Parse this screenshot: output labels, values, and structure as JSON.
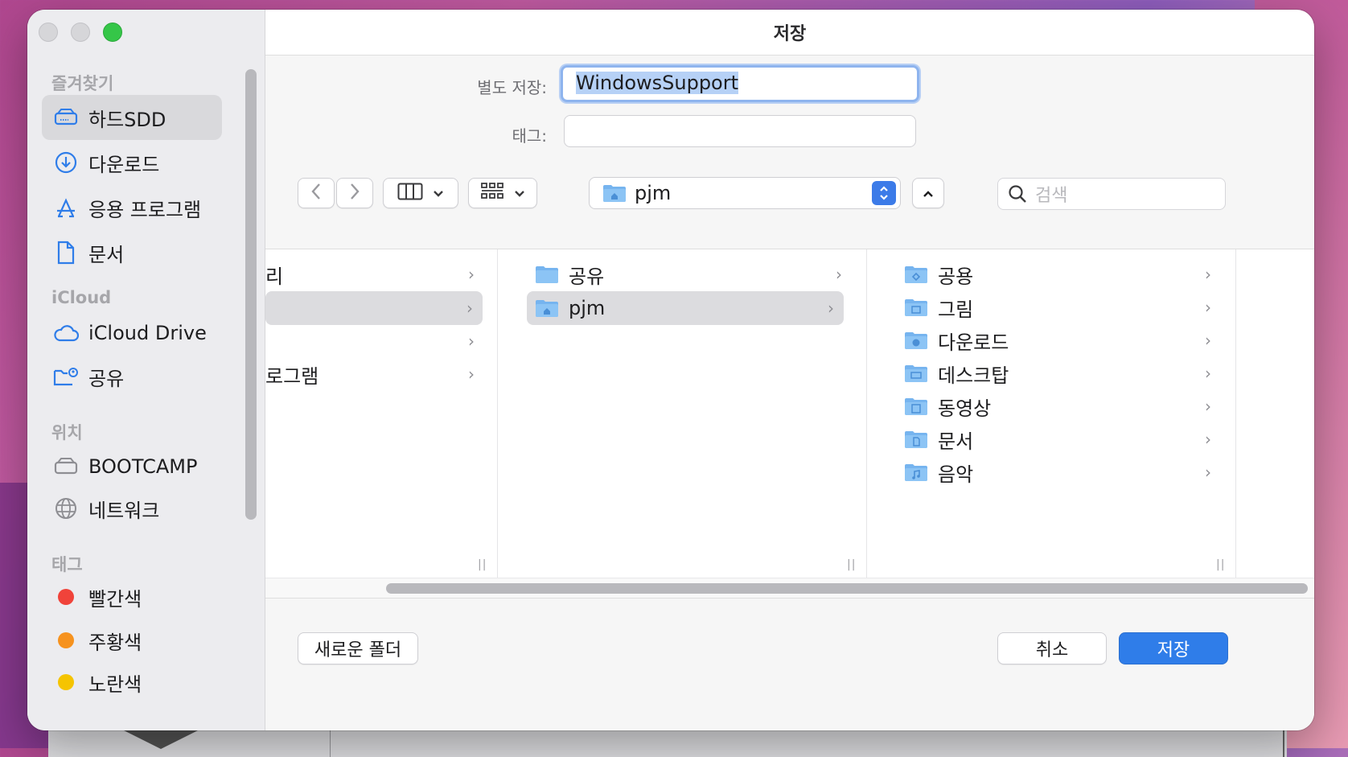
{
  "dialog": {
    "title": "저장"
  },
  "form": {
    "save_as_label": "별도 저장:",
    "save_as_value": "WindowsSupport",
    "tags_label": "태그:",
    "tags_value": ""
  },
  "toolbar": {
    "location": "pjm",
    "search_placeholder": "검색"
  },
  "sidebar": {
    "favorites_heading": "즐겨찾기",
    "favorites": [
      {
        "label": "하드SDD",
        "icon": "drive-icon",
        "selected": true
      },
      {
        "label": "다운로드",
        "icon": "download-icon"
      },
      {
        "label": "응용 프로그램",
        "icon": "applications-icon"
      },
      {
        "label": "문서",
        "icon": "document-icon"
      }
    ],
    "icloud_heading": "iCloud",
    "icloud": [
      {
        "label": "iCloud Drive",
        "icon": "cloud-icon"
      },
      {
        "label": "공유",
        "icon": "shared-folder-icon"
      }
    ],
    "locations_heading": "위치",
    "locations": [
      {
        "label": "BOOTCAMP",
        "icon": "drive-icon"
      },
      {
        "label": "네트워크",
        "icon": "network-icon"
      }
    ],
    "tags_heading": "태그",
    "tags": [
      {
        "label": "빨간색",
        "color": "#f0433a"
      },
      {
        "label": "주황색",
        "color": "#f6921e"
      },
      {
        "label": "노란색",
        "color": "#f5c400"
      }
    ]
  },
  "browser": {
    "col1": [
      "리",
      "",
      "",
      "로그램"
    ],
    "col2": [
      {
        "label": "공유",
        "icon": "folder-icon"
      },
      {
        "label": "pjm",
        "icon": "home-folder-icon",
        "selected": true
      }
    ],
    "col3": [
      {
        "label": "공용",
        "icon": "public-folder-icon"
      },
      {
        "label": "그림",
        "icon": "pictures-folder-icon"
      },
      {
        "label": "다운로드",
        "icon": "downloads-folder-icon"
      },
      {
        "label": "데스크탑",
        "icon": "desktop-folder-icon"
      },
      {
        "label": "동영상",
        "icon": "movies-folder-icon"
      },
      {
        "label": "문서",
        "icon": "documents-folder-icon"
      },
      {
        "label": "음악",
        "icon": "music-folder-icon"
      }
    ]
  },
  "footer": {
    "new_folder": "새로운 폴더",
    "cancel": "취소",
    "save": "저장"
  },
  "colors": {
    "accent": "#2f7de9",
    "sidebar_icon": "#2f7de9"
  }
}
